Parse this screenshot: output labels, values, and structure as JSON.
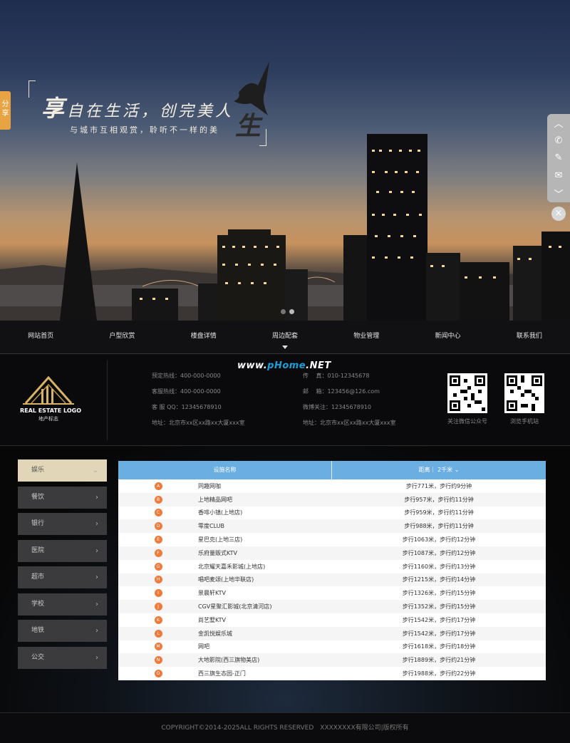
{
  "hero": {
    "slogan_big_char": "享",
    "slogan_main": "自在生活，创完美人",
    "slogan_big_char2": "生",
    "slogan_sub": "与城市互相观赏，聆听不一样的美",
    "share_label": "分享",
    "right_bar_icons": [
      "chevron-up-icon",
      "phone-icon",
      "edit-icon",
      "mail-icon",
      "chevron-down-icon"
    ],
    "close_icon": "close-icon"
  },
  "nav": {
    "items": [
      "网站首页",
      "户型欣赏",
      "楼盘详情",
      "周边配套",
      "物业管理",
      "新闻中心",
      "联系我们"
    ],
    "active_index": 3
  },
  "info": {
    "watermark_prefix": "www.",
    "watermark_brand": "pHome",
    "watermark_suffix": ".NET",
    "logo_en": "REAL ESTATE LOGO",
    "logo_cn": "地产标志",
    "col1": [
      "预定热线：400-000-0000",
      "客服热线：400-000-0000",
      "客 服 QQ：12345678910",
      "地址：北京市xx区xx路xx大厦xxx室"
    ],
    "col2": [
      "传　 真：010-12345678",
      "邮　 箱：123456@126.com",
      "微博关注：12345678910",
      "地址：北京市xx区xx路xx大厦xxx室"
    ],
    "qr1_label": "关注微信公众号",
    "qr2_label": "浏览手机站"
  },
  "sidebar": {
    "items": [
      "娱乐",
      "餐饮",
      "银行",
      "医院",
      "超市",
      "学校",
      "地铁",
      "公交"
    ],
    "active_index": 0
  },
  "table": {
    "header_name": "设施名称",
    "header_dist": "距离｜ 2千米 ⌄",
    "rows": [
      {
        "letter": "A",
        "name": "同趣网咖",
        "dist": "步行771米，步行约9分钟"
      },
      {
        "letter": "B",
        "name": "上地精品网吧",
        "dist": "步行957米，步行约11分钟"
      },
      {
        "letter": "C",
        "name": "香啡小镇(上地店)",
        "dist": "步行959米，步行约11分钟"
      },
      {
        "letter": "D",
        "name": "零度CLUB",
        "dist": "步行988米，步行约11分钟"
      },
      {
        "letter": "E",
        "name": "星巴克(上地三店)",
        "dist": "步行1063米，步行约12分钟"
      },
      {
        "letter": "F",
        "name": "乐府量贩式KTV",
        "dist": "步行1087米，步行约12分钟"
      },
      {
        "letter": "G",
        "name": "北京耀天嘉禾影城(上地店)",
        "dist": "步行1160米，步行约13分钟"
      },
      {
        "letter": "H",
        "name": "唱吧麦颂(上地华联店)",
        "dist": "步行1215米，步行约14分钟"
      },
      {
        "letter": "I",
        "name": "景晨轩KTV",
        "dist": "步行1326米，步行约15分钟"
      },
      {
        "letter": "J",
        "name": "CGV星聚汇影城(北京清河店)",
        "dist": "步行1352米，步行约15分钟"
      },
      {
        "letter": "K",
        "name": "尚艺墅KTV",
        "dist": "步行1542米，步行约17分钟"
      },
      {
        "letter": "L",
        "name": "金凯悦娱乐城",
        "dist": "步行1542米，步行约17分钟"
      },
      {
        "letter": "M",
        "name": "网吧",
        "dist": "步行1618米，步行约18分钟"
      },
      {
        "letter": "N",
        "name": "大地影院(西三旗物美店)",
        "dist": "步行1889米，步行约21分钟"
      },
      {
        "letter": "O",
        "name": "西三旗生态园-正门",
        "dist": "步行1988米，步行约22分钟"
      }
    ]
  },
  "footer": {
    "text": "COPYRIGHT©2014-2025ALL RIGHTS RESERVED　XXXXXXXX有限公司|版权所有"
  }
}
